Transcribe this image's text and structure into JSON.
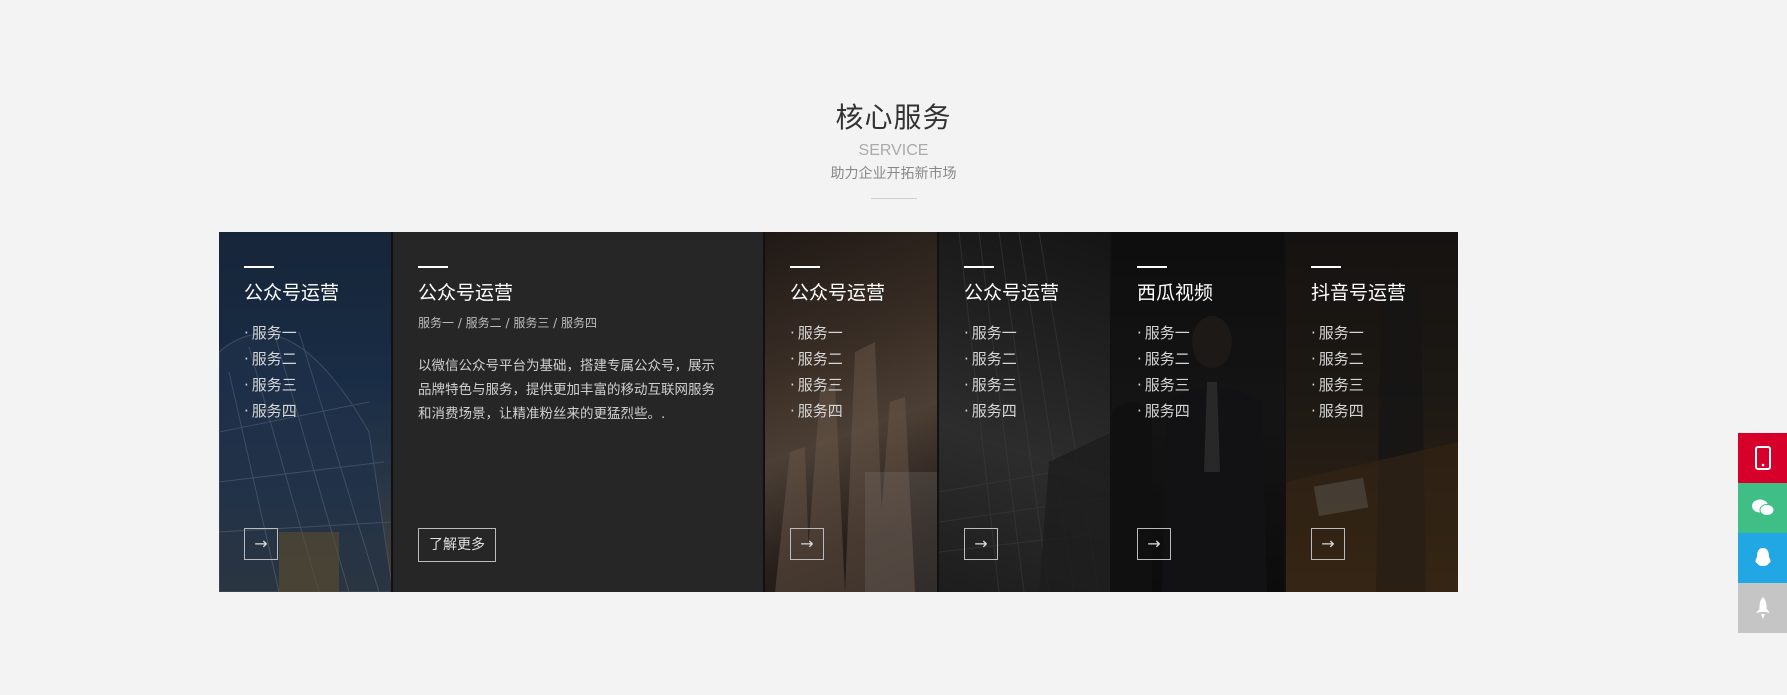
{
  "header": {
    "title": "核心服务",
    "subtitle": "SERVICE",
    "desc": "助力企业开拓新市场"
  },
  "cards": [
    {
      "title": "公众号运营",
      "items": [
        "服务一",
        "服务二",
        "服务三",
        "服务四"
      ],
      "arrow": "→"
    },
    {
      "title": "公众号运营",
      "tags": "服务一 / 服务二 / 服务三 / 服务四",
      "body": "以微信公众号平台为基础，搭建专属公众号，展示品牌特色与服务，提供更加丰富的移动互联网服务和消费场景，让精准粉丝来的更猛烈些。.",
      "more": "了解更多"
    },
    {
      "title": "公众号运营",
      "items": [
        "服务一",
        "服务二",
        "服务三",
        "服务四"
      ],
      "arrow": "→"
    },
    {
      "title": "公众号运营",
      "items": [
        "服务一",
        "服务二",
        "服务三",
        "服务四"
      ],
      "arrow": "→"
    },
    {
      "title": "西瓜视频",
      "items": [
        "服务一",
        "服务二",
        "服务三",
        "服务四"
      ],
      "arrow": "→"
    },
    {
      "title": "抖音号运营",
      "items": [
        "服务一",
        "服务二",
        "服务三",
        "服务四"
      ],
      "arrow": "→"
    }
  ],
  "side_toolbar": {
    "icons": [
      "mobile-icon",
      "wechat-icon",
      "qq-icon",
      "rocket-icon"
    ],
    "colors": [
      "#d7002a",
      "#3fbf86",
      "#21a7e3",
      "#c5c5c5"
    ]
  }
}
